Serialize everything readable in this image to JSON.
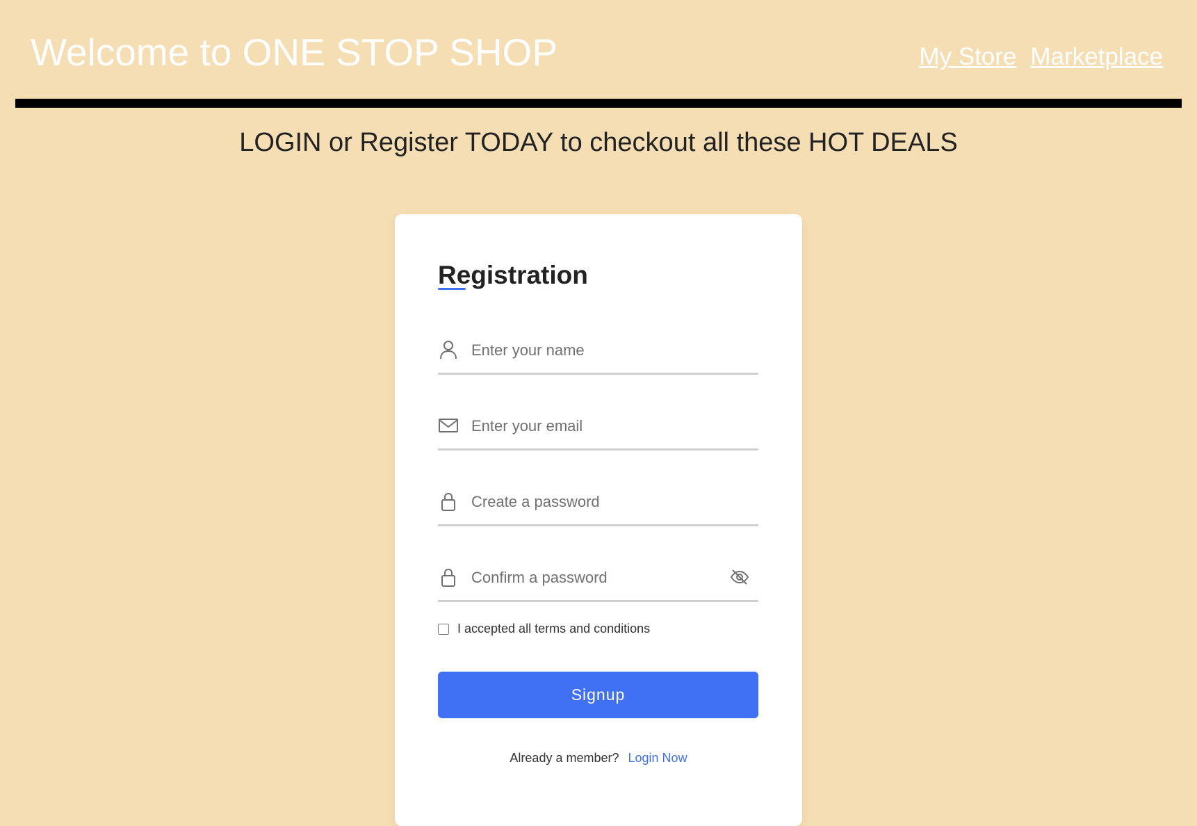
{
  "header": {
    "title": "Welcome to ONE STOP SHOP",
    "nav": [
      {
        "label": "My Store"
      },
      {
        "label": "Marketplace"
      }
    ]
  },
  "tagline": "LOGIN or Register TODAY to checkout all these HOT DEALS",
  "form": {
    "title": "Registration",
    "fields": {
      "name": {
        "placeholder": "Enter your name",
        "value": "",
        "icon": "user-icon"
      },
      "email": {
        "placeholder": "Enter your email",
        "value": "",
        "icon": "envelope-icon"
      },
      "password": {
        "placeholder": "Create a password",
        "value": "",
        "icon": "lock-icon"
      },
      "confirm": {
        "placeholder": "Confirm a password",
        "value": "",
        "icon": "lock-icon",
        "toggle_icon": "eye-slash-icon"
      }
    },
    "terms_label": "I accepted all terms and conditions",
    "terms_checked": false,
    "submit_label": "Signup",
    "footer_text": "Already a member?",
    "login_link": "Login Now"
  },
  "colors": {
    "background": "#f5deb3",
    "accent": "#4070f4",
    "divider": "#000000"
  }
}
